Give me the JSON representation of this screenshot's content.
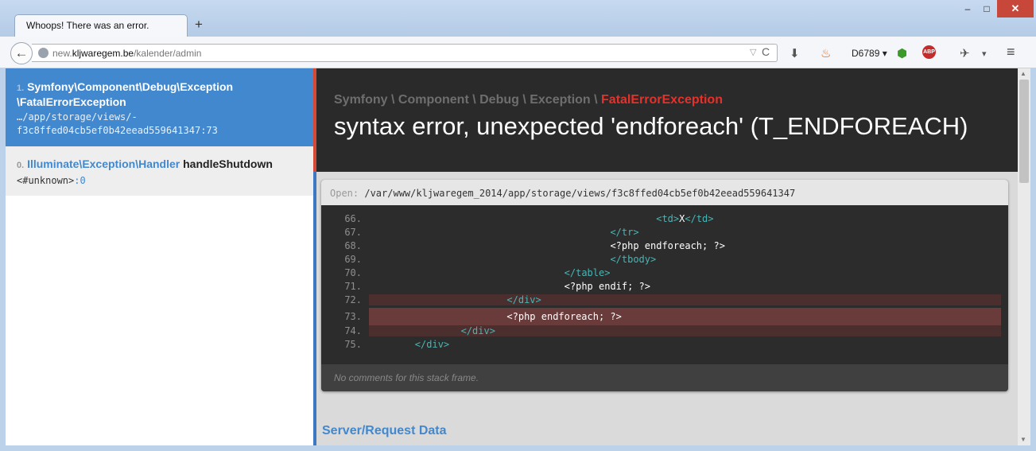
{
  "browser": {
    "tab_title": "Whoops! There was an error.",
    "new_tab": "+",
    "window_controls": {
      "minimize": "–",
      "maximize": "□",
      "close": "✕"
    },
    "back": "←",
    "url_domain_prefix": "new.",
    "url_domain": "kljwaregem.be",
    "url_path": "/kalender/admin",
    "url_dropdown": "▽",
    "reload": "C",
    "toolbar": {
      "download": "⬇",
      "extension": "♨",
      "profile_label": "D6789 ▾",
      "green": "⬢",
      "abp": "ABP",
      "bug": "✈",
      "dropdown": "▾",
      "menu": "≡"
    }
  },
  "stack": [
    {
      "index": "1.",
      "class_line1": "Symfony\\Component\\Debug\\Exception",
      "class_line2": "\\FatalErrorException",
      "file_line1": "…/app/storage/views/-",
      "file_line2": "f3c8ffed04cb5ef0b42eead559641347:73"
    },
    {
      "index": "0.",
      "class_name": "Illuminate\\Exception\\Handler",
      "method": "handleShutdown",
      "file": "<#unknown>",
      "line": ":0"
    }
  ],
  "exception": {
    "namespace": "Symfony \\ Component \\ Debug \\ Exception \\ ",
    "class": "FatalErrorException",
    "message": "syntax error, unexpected 'endforeach' (T_ENDFOREACH)"
  },
  "code": {
    "open_label": "Open:",
    "open_path": "/var/www/kljwaregem_2014/app/storage/views/f3c8ffed04cb5ef0b42eead559641347",
    "lines": [
      {
        "num": "66.",
        "indent": "                                                  ",
        "parts": [
          [
            "tag",
            "<td>"
          ],
          [
            "txt",
            "X"
          ],
          [
            "tag",
            "</td>"
          ]
        ]
      },
      {
        "num": "67.",
        "indent": "                                          ",
        "parts": [
          [
            "tag",
            "</tr>"
          ]
        ]
      },
      {
        "num": "68.",
        "indent": "                                          ",
        "parts": [
          [
            "txt",
            "<?php endforeach; ?>"
          ]
        ]
      },
      {
        "num": "69.",
        "indent": "                                          ",
        "parts": [
          [
            "tag",
            "</tbody>"
          ]
        ]
      },
      {
        "num": "70.",
        "indent": "                                  ",
        "parts": [
          [
            "tag",
            "</table>"
          ]
        ]
      },
      {
        "num": "71.",
        "indent": "                                  ",
        "parts": [
          [
            "txt",
            "<?php endif; ?>"
          ]
        ]
      },
      {
        "num": "72.",
        "indent": "                        ",
        "parts": [
          [
            "tag",
            "</div>"
          ]
        ]
      },
      {
        "num": "73.",
        "indent": "                        ",
        "parts": [
          [
            "txt",
            "<?php endforeach; ?>"
          ]
        ]
      },
      {
        "num": "74.",
        "indent": "                ",
        "parts": [
          [
            "tag",
            "</div>"
          ]
        ]
      },
      {
        "num": "75.",
        "indent": "        ",
        "parts": [
          [
            "tag",
            "</div>"
          ]
        ]
      }
    ],
    "comment": "No comments for this stack frame."
  },
  "section": {
    "server_request_title": "Server/Request Data"
  },
  "scrollbar": {
    "up": "▲",
    "down": "▼"
  }
}
